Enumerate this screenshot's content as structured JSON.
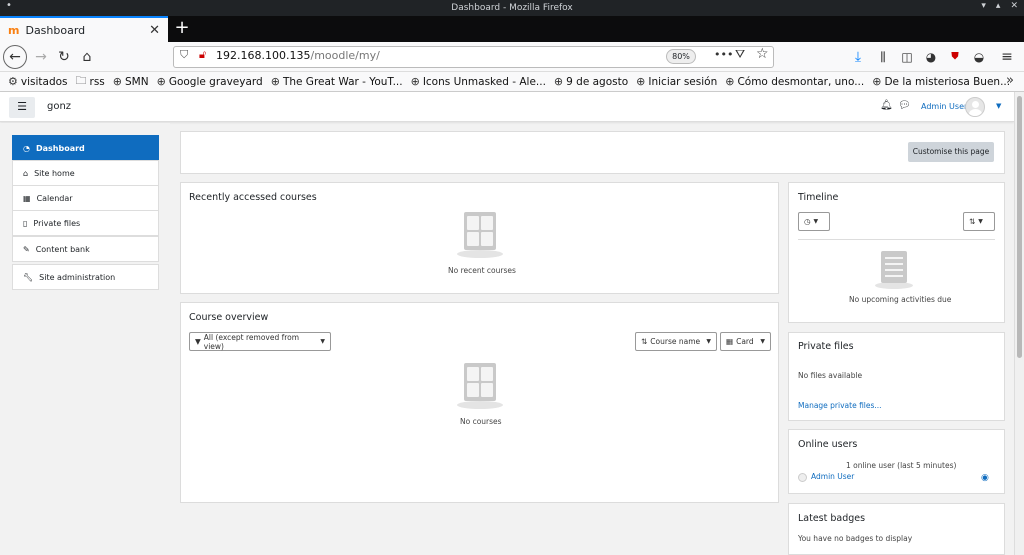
{
  "window": {
    "title": "Dashboard - Mozilla Firefox"
  },
  "tab": {
    "title": "Dashboard",
    "favicon": "m"
  },
  "nav": {
    "url_host": "192.168.100.135",
    "url_path": "/moodle/my/",
    "zoom": "80%"
  },
  "bookmarks": [
    {
      "label": "visitados",
      "icon": "gear-icon"
    },
    {
      "label": "rss",
      "icon": "folder-icon"
    },
    {
      "label": "SMN",
      "icon": "globe-icon"
    },
    {
      "label": "Google graveyard",
      "icon": "globe-icon"
    },
    {
      "label": "The Great War - YouT...",
      "icon": "globe-icon"
    },
    {
      "label": "Icons Unmasked - Ale...",
      "icon": "globe-icon"
    },
    {
      "label": "9 de agosto",
      "icon": "globe-icon"
    },
    {
      "label": "Iniciar sesión",
      "icon": "globe-icon"
    },
    {
      "label": "Cómo desmontar, uno...",
      "icon": "globe-icon"
    },
    {
      "label": "De la misteriosa Buen...",
      "icon": "globe-icon"
    }
  ],
  "header": {
    "site_name": "gonz",
    "user_name": "Admin User"
  },
  "drawer": {
    "items": [
      {
        "label": "Dashboard",
        "active": true
      },
      {
        "label": "Site home"
      },
      {
        "label": "Calendar"
      },
      {
        "label": "Private files"
      },
      {
        "label": "Content bank"
      }
    ],
    "admin": "Site administration"
  },
  "main": {
    "customise_label": "Customise this page",
    "recent": {
      "title": "Recently accessed courses",
      "empty": "No recent courses"
    },
    "overview": {
      "title": "Course overview",
      "filter": "All (except removed from view)",
      "sort": "Course name",
      "view": "Card",
      "empty": "No courses"
    }
  },
  "blocks": {
    "timeline": {
      "title": "Timeline",
      "empty": "No upcoming activities due"
    },
    "private_files": {
      "title": "Private files",
      "empty": "No files available",
      "link": "Manage private files..."
    },
    "online_users": {
      "title": "Online users",
      "summary": "1 online user (last 5 minutes)",
      "user": "Admin User"
    },
    "badges": {
      "title": "Latest badges",
      "empty": "You have no badges to display"
    }
  },
  "colors": {
    "accent": "#0f6cbf",
    "firefox_tab_accent": "#0a84ff"
  }
}
